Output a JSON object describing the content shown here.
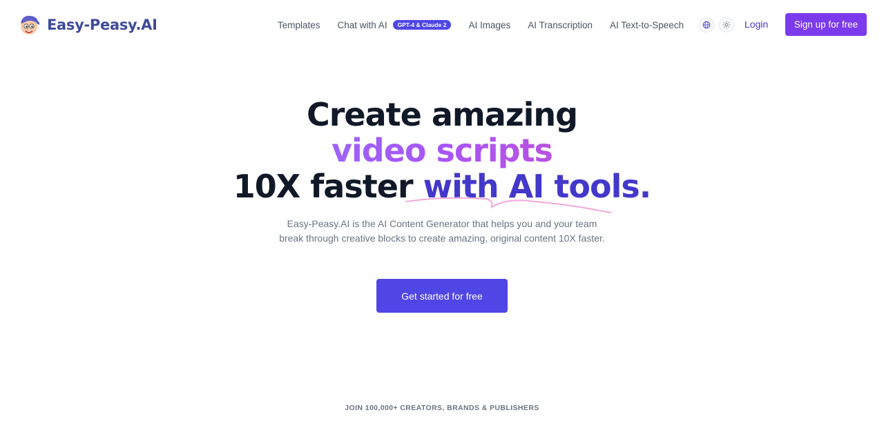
{
  "header": {
    "brand_name": "Easy-Peasy.AI",
    "nav": {
      "templates": "Templates",
      "chat": "Chat with AI",
      "chat_badge": "GPT-4 & Claude 2",
      "images": "AI Images",
      "transcription": "AI Transcription",
      "tts": "AI Text-to-Speech"
    },
    "icons": [
      "globe-icon",
      "sun-icon"
    ],
    "login_label": "Login",
    "signup_label": "Sign up for free"
  },
  "hero": {
    "line1": "Create amazing",
    "line2": "video scripts",
    "line3_plain": "10X faster ",
    "line3_highlight": "with AI tools.",
    "subtitle": "Easy-Peasy.AI is the AI Content Generator that helps you and your team break through creative blocks to create amazing, original content 10X faster.",
    "cta_label": "Get started for free"
  },
  "social_proof": {
    "text": "JOIN 100,000+ CREATORS, BRANDS & PUBLISHERS"
  },
  "colors": {
    "brand": "#3f4a9a",
    "primary": "#4f46e5",
    "signup": "#7c3aed",
    "highlight": "#4338ca",
    "gradient_start": "#818cf8",
    "gradient_end": "#ec4899"
  }
}
